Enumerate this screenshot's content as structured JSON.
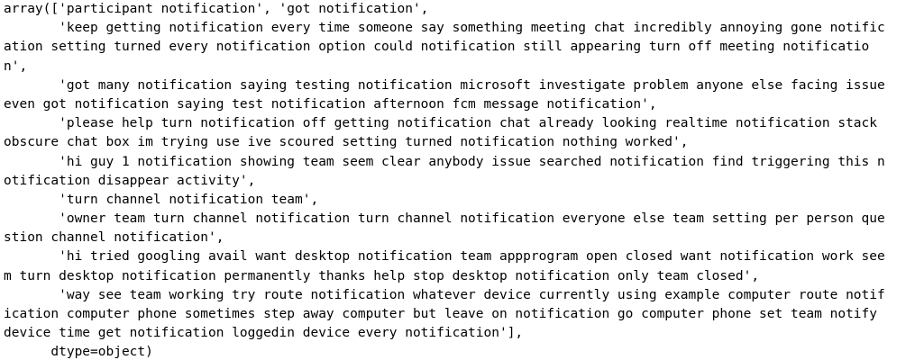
{
  "output": {
    "lines": [
      "array(['participant notification', 'got notification',",
      "       'keep getting notification every time someone say something meeting chat incredibly annoying gone notific",
      "ation setting turned every notification option could notification still appearing turn off meeting notificatio",
      "n',",
      "       'got many notification saying testing notification microsoft investigate problem anyone else facing issue",
      "even got notification saying test notification afternoon fcm message notification',",
      "       'please help turn notification off getting notification chat already looking realtime notification stack",
      "obscure chat box im trying use ive scoured setting turned notification nothing worked',",
      "       'hi guy 1 notification showing team seem clear anybody issue searched notification find triggering this n",
      "otification disappear activity',",
      "       'turn channel notification team',",
      "       'owner team turn channel notification turn channel notification everyone else team setting per person que",
      "stion channel notification',",
      "       'hi tried googling avail want desktop notification team appprogram open closed want notification work see",
      "m turn desktop notification permanently thanks help stop desktop notification only team closed',",
      "       'way see team working try route notification whatever device currently using example computer route notif",
      "ication computer phone sometimes step away computer but leave on notification go computer phone set team notify",
      "device time get notification loggedin device every notification'],",
      "      dtype=object)"
    ]
  }
}
